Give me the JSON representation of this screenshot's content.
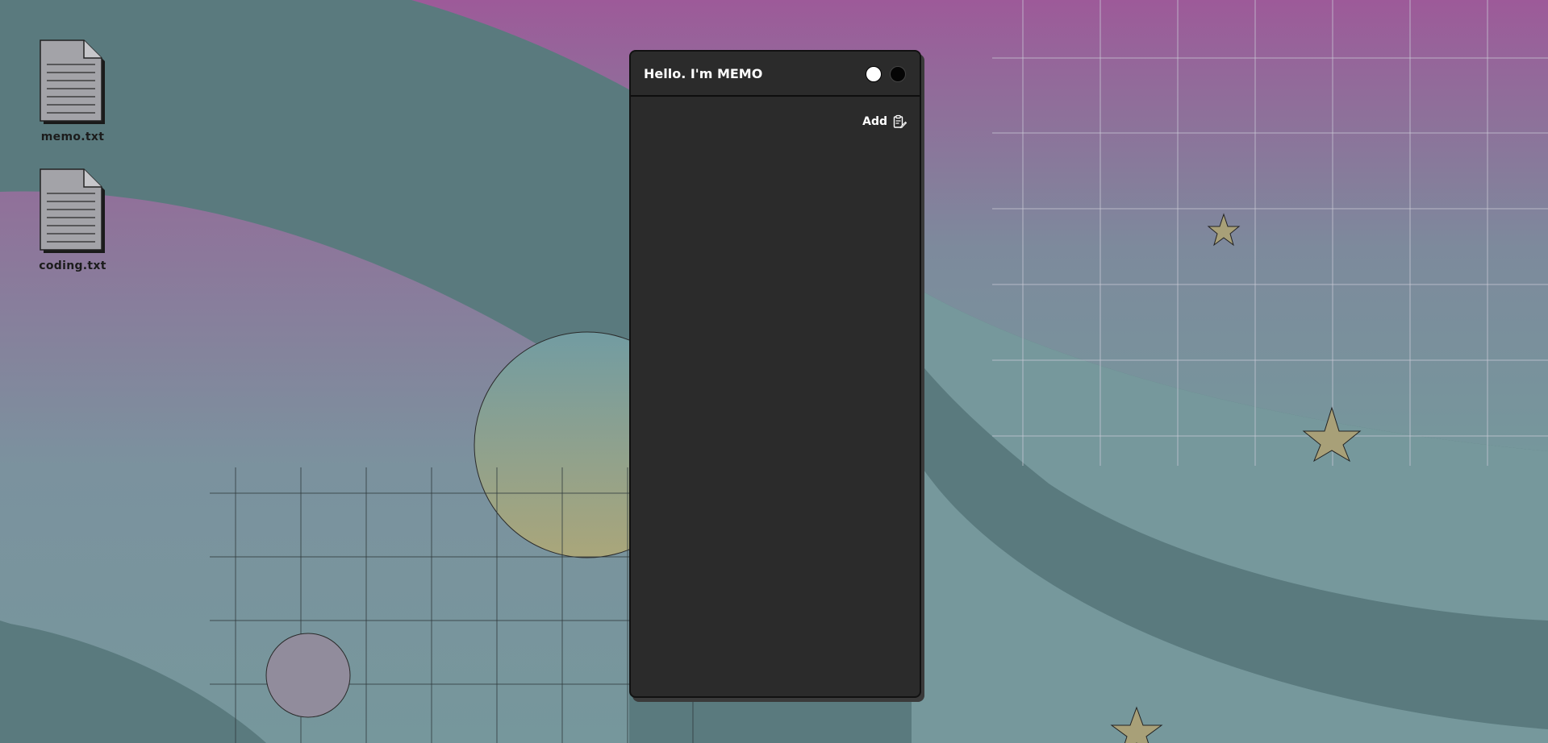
{
  "desktop": {
    "files": [
      {
        "label": "memo.txt",
        "icon": "text-file-icon"
      },
      {
        "label": "coding.txt",
        "icon": "text-file-icon"
      }
    ]
  },
  "memo_window": {
    "title": "Hello. I'm MEMO",
    "add_label": "Add",
    "add_icon": "clipboard-edit-icon",
    "controls": [
      "light-circle-button",
      "dark-circle-button"
    ]
  },
  "colors": {
    "window_bg": "#2b2b2b",
    "teal_bg": "#5a7a7e",
    "light_teal": "#76989c",
    "purple": "#9b5a9a",
    "star": "#a8a078",
    "circle_lavender": "#918c9c"
  }
}
